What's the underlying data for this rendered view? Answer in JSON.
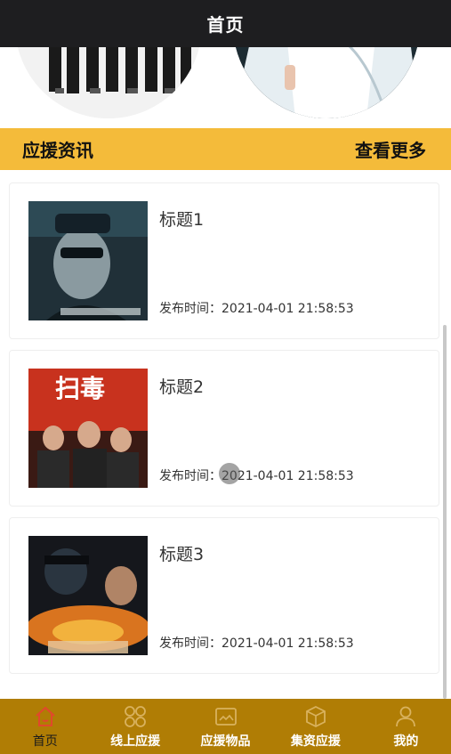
{
  "header": {
    "title": "首页"
  },
  "section": {
    "title": "应援资讯",
    "more": "查看更多"
  },
  "news": [
    {
      "title": "标题1",
      "time": "发布时间：2021-04-01 21:58:53"
    },
    {
      "title": "标题2",
      "time": "发布时间：2021-04-01 21:58:53"
    },
    {
      "title": "标题3",
      "time": "发布时间：2021-04-01 21:58:53"
    }
  ],
  "tabbar": {
    "active": "home",
    "items": [
      {
        "label": "首页",
        "icon": "home-icon"
      },
      {
        "label": "线上应援",
        "icon": "grid-icon"
      },
      {
        "label": "应援物品",
        "icon": "image-icon"
      },
      {
        "label": "集资应援",
        "icon": "box-icon"
      },
      {
        "label": "我的",
        "icon": "user-icon"
      }
    ]
  },
  "colors": {
    "header_bg": "#1e1e20",
    "accent": "#f4bb3a",
    "tabbar_bg": "#b07d05",
    "active_icon": "#e0492b"
  }
}
